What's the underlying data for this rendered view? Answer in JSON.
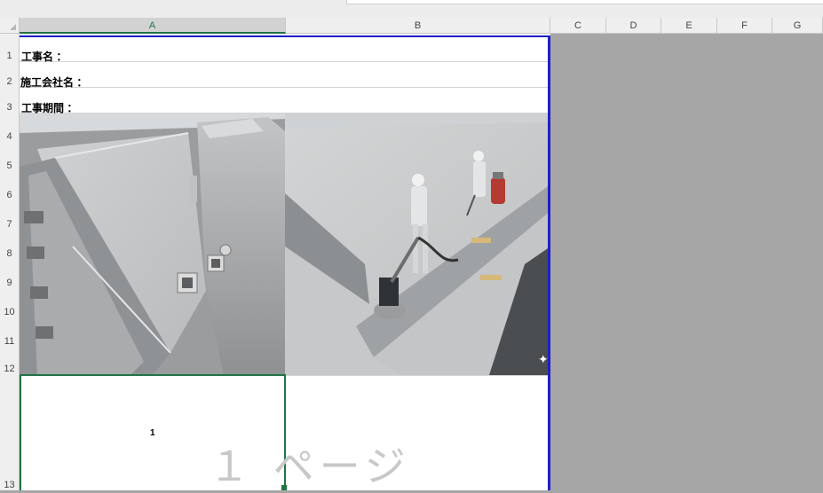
{
  "columns": [
    {
      "id": "col-a",
      "label": "A",
      "selected": true
    },
    {
      "id": "col-b",
      "label": "B",
      "selected": false
    },
    {
      "id": "col-c",
      "label": "C",
      "selected": false
    },
    {
      "id": "col-d",
      "label": "D",
      "selected": false
    },
    {
      "id": "col-e",
      "label": "E",
      "selected": false
    },
    {
      "id": "col-f",
      "label": "F",
      "selected": false
    },
    {
      "id": "col-g",
      "label": "G",
      "selected": false
    }
  ],
  "rows": [
    "1",
    "2",
    "3",
    "4",
    "5",
    "6",
    "7",
    "8",
    "9",
    "10",
    "11",
    "12",
    "13"
  ],
  "cells": {
    "a1": "工事名 ：",
    "a2": "施工会社名 ：",
    "a3": "工事期間 ："
  },
  "page": {
    "watermark": "１ ページ",
    "number": "1"
  },
  "colors": {
    "page_border": "#1f1fc8",
    "selection": "#217346",
    "outside_page": "#a6a6a6"
  }
}
